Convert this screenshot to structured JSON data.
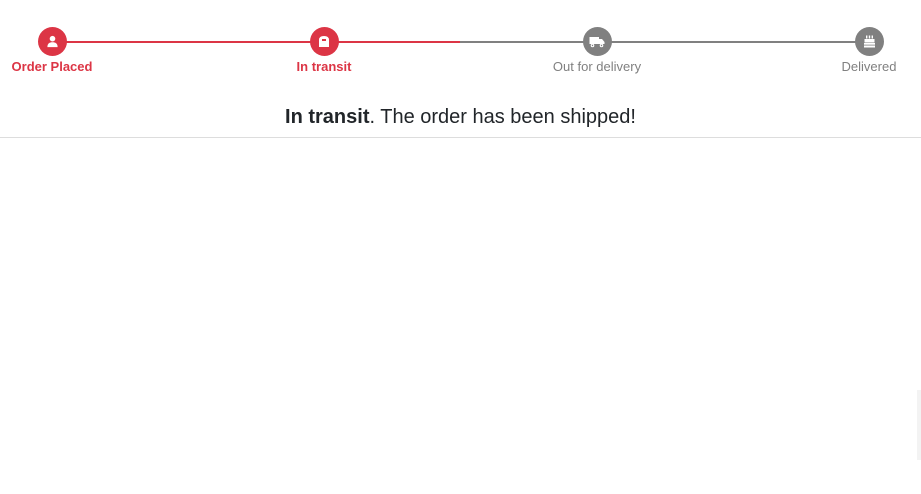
{
  "tracker": {
    "steps": [
      {
        "label": "Order Placed",
        "icon": "user-icon",
        "state": "completed"
      },
      {
        "label": "In transit",
        "icon": "box-icon",
        "state": "current"
      },
      {
        "label": "Out for delivery",
        "icon": "truck-icon",
        "state": "pending"
      },
      {
        "label": "Delivered",
        "icon": "gift-icon",
        "state": "pending"
      }
    ],
    "progress": 0.5
  },
  "status": {
    "headline": "In transit",
    "message": ". The order has been shipped!"
  },
  "colors": {
    "active": "#dc3545",
    "pending": "#808080",
    "text": "#212529",
    "divider": "#dddddd"
  }
}
